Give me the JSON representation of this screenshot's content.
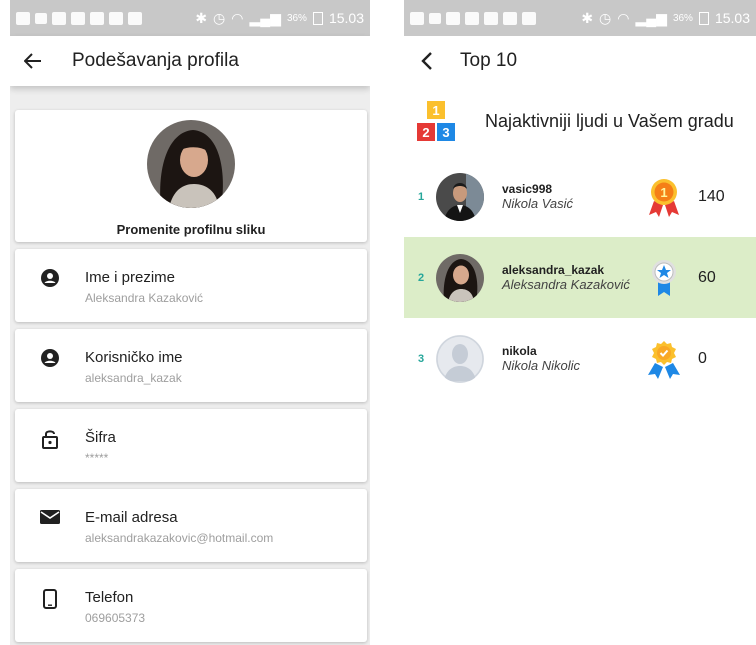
{
  "status_bar": {
    "battery": "36%",
    "time": "15.03"
  },
  "profile_screen": {
    "title": "Podešavanja profila",
    "change_photo": "Promenite profilnu sliku",
    "fields": [
      {
        "icon": "person-icon",
        "label": "Ime i prezime",
        "value": "Aleksandra Kazaković"
      },
      {
        "icon": "person-icon",
        "label": "Korisničko ime",
        "value": "aleksandra_kazak"
      },
      {
        "icon": "lock-icon",
        "label": "Šifra",
        "value": "*****"
      },
      {
        "icon": "email-icon",
        "label": "E-mail adresa",
        "value": "aleksandrakazakovic@hotmail.com"
      },
      {
        "icon": "phone-icon",
        "label": "Telefon",
        "value": "069605373"
      }
    ]
  },
  "top_screen": {
    "title": "Top 10",
    "heading": "Najaktivniji ljudi u Vašem gradu",
    "medal_numbers": [
      "1",
      "2",
      "3"
    ],
    "entries": [
      {
        "rank": "1",
        "username": "vasic998",
        "name": "Nikola Vasić",
        "points": "140",
        "badge": "gold-medal-icon",
        "highlighted": false
      },
      {
        "rank": "2",
        "username": "aleksandra_kazak",
        "name": "Aleksandra Kazaković",
        "points": "60",
        "badge": "star-ribbon-icon",
        "highlighted": true
      },
      {
        "rank": "3",
        "username": "nikola",
        "name": "Nikola Nikolic",
        "points": "0",
        "badge": "check-badge-icon",
        "highlighted": false
      }
    ]
  },
  "colors": {
    "highlight_row": "#dcedc8",
    "rank_text": "#26a69a",
    "medal_yellow": "#fbc02d",
    "medal_red": "#e53935",
    "medal_blue": "#1e88e5"
  }
}
